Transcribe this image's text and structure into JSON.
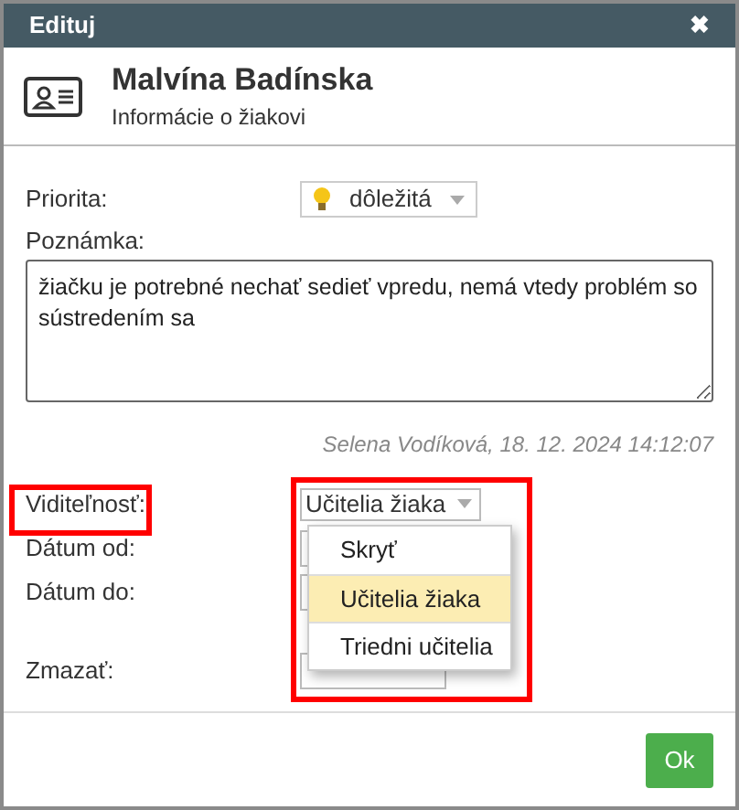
{
  "window": {
    "title": "Edituj",
    "close": "✖"
  },
  "header": {
    "name": "Malvína Badínska",
    "subtitle": "Informácie o žiakovi"
  },
  "form": {
    "priority": {
      "label": "Priorita:",
      "value": "dôležitá"
    },
    "note": {
      "label": "Poznámka:",
      "value": "žiačku je potrebné nechať sedieť vpredu, nemá vtedy problém so sústredením sa"
    },
    "author": "Selena Vodíková, 18. 12. 2024 14:12:07",
    "visibility": {
      "label": "Viditeľnosť:",
      "value": "Učitelia žiaka",
      "highlighted": true,
      "expanded": true,
      "options": [
        {
          "label": "Skryť",
          "selected": false
        },
        {
          "label": "Učitelia žiaka",
          "selected": true
        },
        {
          "label": "Triedni učitelia",
          "selected": false
        }
      ]
    },
    "date_from": {
      "label": "Dátum od:"
    },
    "date_to": {
      "label": "Dátum do:"
    },
    "delete": {
      "label": "Zmazať:"
    }
  },
  "footer": {
    "ok": "Ok"
  }
}
